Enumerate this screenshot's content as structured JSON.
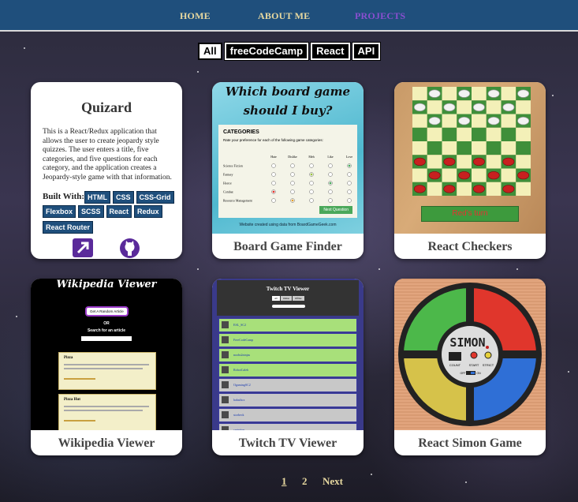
{
  "nav": {
    "home": "HOME",
    "about": "ABOUT ME",
    "projects": "PROJECTS"
  },
  "filters": [
    "All",
    "freeCodeCamp",
    "React",
    "API"
  ],
  "quizard": {
    "title": "Quizard",
    "description": "This is a React/Redux application that allows the user to create jeopardy style quizzes. The user enters a title, five categories, and five questions for each category, and the application creates a Jeopardy-style game with that information.",
    "built_with_label": "Built With:",
    "tags": [
      "HTML",
      "CSS",
      "CSS-Grid",
      "Flexbox",
      "SCSS",
      "React",
      "Redux",
      "React Router"
    ]
  },
  "cards": {
    "board": {
      "title": "Board Game Finder",
      "banner": "Which board game should I buy?",
      "categories_heading": "CATEGORIES",
      "prompt": "Rate your preference for each of the following game categories:",
      "columns": [
        "Hate",
        "Dislike",
        "Meh",
        "Like",
        "Love"
      ],
      "rows": [
        "Science Fiction",
        "Fantasy",
        "Horror",
        "Combat",
        "Resource Management"
      ],
      "next": "Next Question",
      "footer": "Website created using data from BoardGameGeek.com"
    },
    "checkers": {
      "title": "React Checkers",
      "turn": "Red's turn"
    },
    "wiki": {
      "title": "Wikipedia Viewer",
      "banner": "Wikipedia Viewer",
      "random": "Get A Random Article",
      "or": "OR",
      "search": "Search for an article",
      "result1_title": "Pizza",
      "result2_title": "Pizza Hut"
    },
    "twitch": {
      "title": "Twitch TV Viewer",
      "banner": "Twitch TV Viewer",
      "filters": [
        "All",
        "Online",
        "Offline"
      ],
      "channels": [
        "ESL_SC2",
        "FreeCodeCamp",
        "noobs2ninjas",
        "RobotCaleb",
        "OgamingSC2",
        "habathcx",
        "storbeck",
        "cretetion"
      ]
    },
    "simon": {
      "title": "React Simon Game",
      "logo": "SIMON",
      "count": "COUNT",
      "start": "START",
      "strict": "STRICT",
      "off": "OFF",
      "on": "ON",
      "colors": {
        "green": "#4cb84a",
        "red": "#e0362c",
        "yellow": "#d6c24a",
        "blue": "#2f6fd6"
      }
    }
  },
  "pager": {
    "p1": "1",
    "p2": "2",
    "next": "Next"
  },
  "colors": {
    "nav": "#1f4f7c",
    "accent_gold": "#e8d9a0",
    "active_purple": "#8a4fd0",
    "tag_blue": "#1f4f7c"
  }
}
